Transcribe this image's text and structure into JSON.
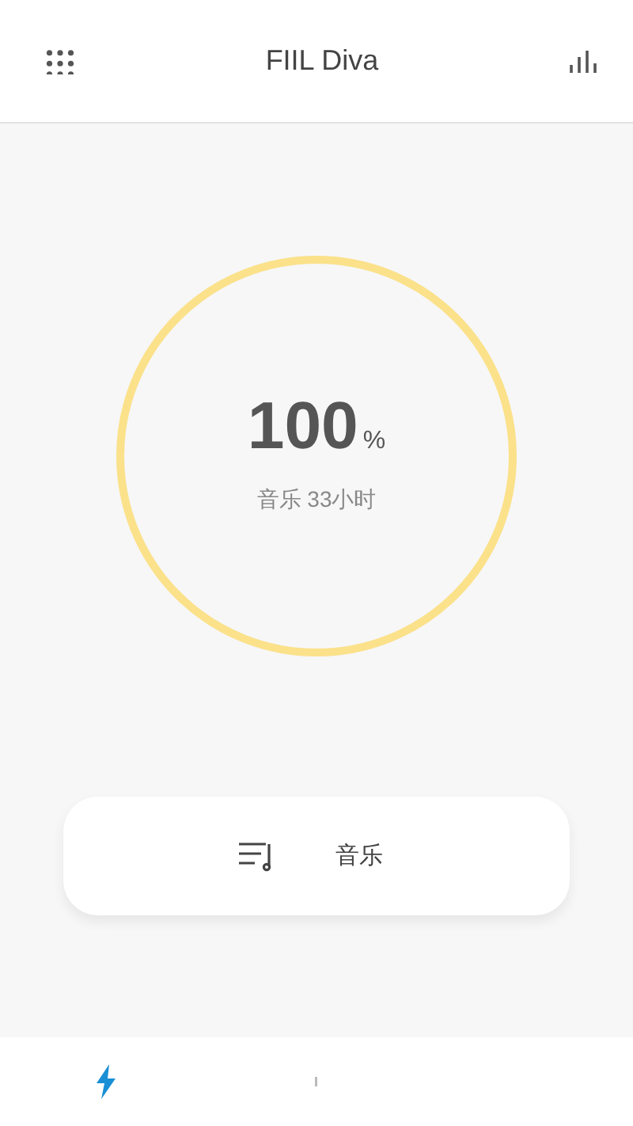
{
  "header": {
    "title": "FIIL Diva"
  },
  "battery": {
    "level": 1,
    "value": "100",
    "unit": "%",
    "caption": "音乐 33小时"
  },
  "mode_card": {
    "label": "音乐"
  },
  "bottom_tabs": [
    {
      "kind": "power",
      "selected": true
    },
    {
      "kind": "bar",
      "selected": false
    }
  ]
}
